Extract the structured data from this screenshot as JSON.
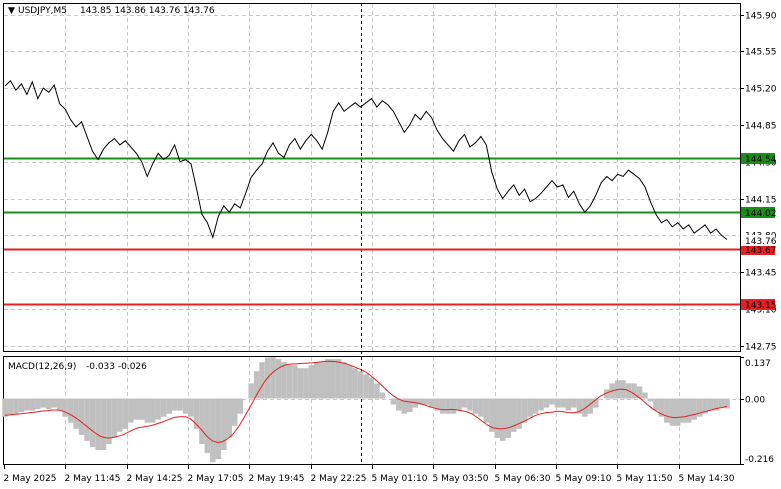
{
  "header": {
    "symbol": "USDJPY,M5",
    "ohlc": "143.85 143.86 143.76 143.76"
  },
  "macd_header": {
    "label": "MACD(12,26,9)",
    "values": "-0.033 -0.026"
  },
  "colors": {
    "support": "#1a8c1a",
    "resistance": "#e52020",
    "price_line": "#000000",
    "histogram": "#c0c0c0",
    "signal": "#e52020",
    "grid": "#c8c8c8"
  },
  "chart_data": [
    {
      "type": "line",
      "title": "USDJPY,M5",
      "y_ticks": [
        "145.90",
        "145.55",
        "145.20",
        "144.85",
        "144.50",
        "144.15",
        "143.80",
        "143.45",
        "143.10",
        "142.75"
      ],
      "ylim": [
        142.7,
        146.0
      ],
      "x_ticks": [
        "2 May 2025",
        "2 May 11:45",
        "2 May 14:25",
        "2 May 17:05",
        "2 May 19:45",
        "2 May 22:25",
        "5 May 01:10",
        "5 May 03:50",
        "5 May 06:30",
        "5 May 09:10",
        "5 May 11:50",
        "5 May 14:30"
      ],
      "price_tag": "143.76",
      "levels": [
        {
          "label": "144.54",
          "value": 144.54,
          "kind": "support"
        },
        {
          "label": "144.02",
          "value": 144.02,
          "kind": "support"
        },
        {
          "label": "143.67",
          "value": 143.67,
          "kind": "resistance"
        },
        {
          "label": "143.15",
          "value": 143.15,
          "kind": "resistance"
        }
      ],
      "close_series": [
        145.22,
        145.27,
        145.18,
        145.24,
        145.14,
        145.26,
        145.1,
        145.2,
        145.16,
        145.23,
        145.05,
        145.0,
        144.9,
        144.83,
        144.88,
        144.74,
        144.6,
        144.52,
        144.62,
        144.68,
        144.72,
        144.66,
        144.7,
        144.64,
        144.58,
        144.5,
        144.36,
        144.48,
        144.58,
        144.52,
        144.56,
        144.66,
        144.5,
        144.52,
        144.48,
        144.25,
        144.0,
        143.92,
        143.78,
        143.98,
        144.08,
        144.02,
        144.1,
        144.06,
        144.2,
        144.35,
        144.42,
        144.48,
        144.6,
        144.68,
        144.58,
        144.54,
        144.66,
        144.72,
        144.62,
        144.7,
        144.76,
        144.7,
        144.62,
        144.78,
        144.98,
        145.06,
        144.98,
        145.02,
        145.06,
        145.02,
        145.06,
        145.1,
        145.02,
        145.08,
        145.04,
        144.98,
        144.88,
        144.78,
        144.85,
        144.95,
        144.9,
        144.98,
        144.92,
        144.8,
        144.72,
        144.66,
        144.6,
        144.7,
        144.76,
        144.64,
        144.68,
        144.74,
        144.66,
        144.4,
        144.24,
        144.15,
        144.22,
        144.28,
        144.18,
        144.24,
        144.12,
        144.15,
        144.2,
        144.26,
        144.32,
        144.26,
        144.28,
        144.16,
        144.22,
        144.1,
        144.02,
        144.08,
        144.18,
        144.3,
        144.36,
        144.32,
        144.38,
        144.36,
        144.42,
        144.38,
        144.34,
        144.26,
        144.12,
        144.0,
        143.92,
        143.95,
        143.88,
        143.92,
        143.86,
        143.9,
        143.82,
        143.86,
        143.9,
        143.82,
        143.86,
        143.8,
        143.76
      ]
    },
    {
      "type": "bar",
      "title": "MACD(12,26,9)",
      "y_ticks": [
        "0.137",
        "0.00",
        "-0.216"
      ],
      "ylim": [
        -0.216,
        0.137
      ],
      "macd": [
        -0.06,
        -0.055,
        -0.05,
        -0.045,
        -0.04,
        -0.04,
        -0.035,
        -0.03,
        -0.035,
        -0.03,
        -0.04,
        -0.06,
        -0.08,
        -0.1,
        -0.12,
        -0.14,
        -0.16,
        -0.17,
        -0.17,
        -0.15,
        -0.13,
        -0.11,
        -0.1,
        -0.08,
        -0.07,
        -0.07,
        -0.08,
        -0.08,
        -0.07,
        -0.06,
        -0.05,
        -0.04,
        -0.04,
        -0.05,
        -0.06,
        -0.1,
        -0.15,
        -0.18,
        -0.21,
        -0.2,
        -0.17,
        -0.13,
        -0.09,
        -0.05,
        0.0,
        0.05,
        0.09,
        0.12,
        0.135,
        0.137,
        0.13,
        0.12,
        0.11,
        0.11,
        0.1,
        0.1,
        0.11,
        0.12,
        0.12,
        0.13,
        0.13,
        0.13,
        0.12,
        0.11,
        0.1,
        0.09,
        0.08,
        0.07,
        0.05,
        0.02,
        0.0,
        -0.02,
        -0.04,
        -0.05,
        -0.045,
        -0.03,
        -0.02,
        -0.02,
        -0.03,
        -0.04,
        -0.05,
        -0.05,
        -0.05,
        -0.04,
        -0.03,
        -0.04,
        -0.05,
        -0.06,
        -0.08,
        -0.11,
        -0.13,
        -0.14,
        -0.13,
        -0.11,
        -0.1,
        -0.08,
        -0.06,
        -0.05,
        -0.04,
        -0.03,
        -0.02,
        -0.03,
        -0.03,
        -0.04,
        -0.03,
        -0.05,
        -0.06,
        -0.05,
        -0.03,
        0.0,
        0.03,
        0.05,
        0.06,
        0.06,
        0.05,
        0.05,
        0.04,
        0.02,
        -0.01,
        -0.04,
        -0.06,
        -0.08,
        -0.09,
        -0.09,
        -0.08,
        -0.08,
        -0.07,
        -0.06,
        -0.05,
        -0.04,
        -0.04,
        -0.03,
        -0.033
      ],
      "signal": [
        -0.055,
        -0.054,
        -0.052,
        -0.05,
        -0.048,
        -0.046,
        -0.044,
        -0.041,
        -0.04,
        -0.038,
        -0.038,
        -0.042,
        -0.05,
        -0.06,
        -0.072,
        -0.086,
        -0.1,
        -0.114,
        -0.125,
        -0.13,
        -0.13,
        -0.126,
        -0.121,
        -0.113,
        -0.104,
        -0.097,
        -0.094,
        -0.091,
        -0.087,
        -0.081,
        -0.075,
        -0.068,
        -0.062,
        -0.06,
        -0.06,
        -0.068,
        -0.084,
        -0.103,
        -0.124,
        -0.139,
        -0.145,
        -0.142,
        -0.132,
        -0.116,
        -0.093,
        -0.064,
        -0.033,
        -0.001,
        0.03,
        0.058,
        0.079,
        0.094,
        0.105,
        0.112,
        0.114,
        0.115,
        0.116,
        0.117,
        0.118,
        0.12,
        0.122,
        0.123,
        0.122,
        0.12,
        0.116,
        0.11,
        0.103,
        0.096,
        0.087,
        0.074,
        0.059,
        0.043,
        0.026,
        0.011,
        -0.001,
        -0.008,
        -0.011,
        -0.013,
        -0.016,
        -0.021,
        -0.027,
        -0.032,
        -0.036,
        -0.037,
        -0.036,
        -0.037,
        -0.04,
        -0.044,
        -0.051,
        -0.063,
        -0.076,
        -0.089,
        -0.097,
        -0.1,
        -0.1,
        -0.096,
        -0.089,
        -0.081,
        -0.073,
        -0.064,
        -0.055,
        -0.05,
        -0.046,
        -0.045,
        -0.042,
        -0.043,
        -0.046,
        -0.047,
        -0.044,
        -0.035,
        -0.022,
        -0.008,
        0.006,
        0.016,
        0.023,
        0.028,
        0.031,
        0.029,
        0.021,
        0.009,
        -0.005,
        -0.02,
        -0.034,
        -0.045,
        -0.054,
        -0.06,
        -0.063,
        -0.062,
        -0.06,
        -0.056,
        -0.052,
        -0.047,
        -0.042,
        -0.038,
        -0.033,
        -0.03,
        -0.026
      ]
    }
  ]
}
